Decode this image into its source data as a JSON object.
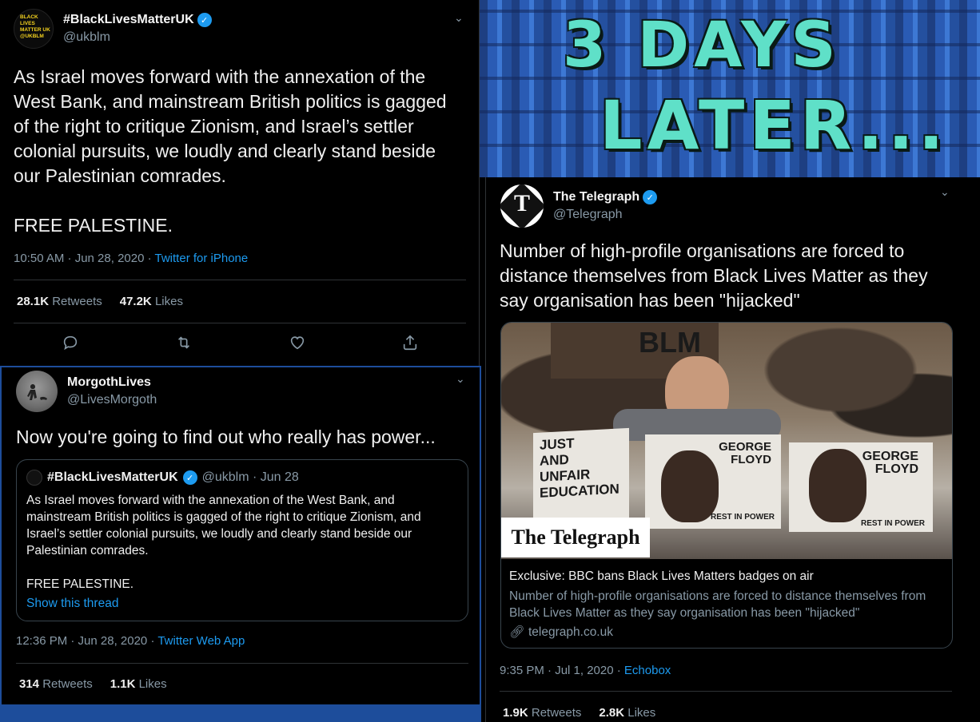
{
  "tweet1": {
    "display_name": "#BlackLivesMatterUK",
    "handle": "@ukblm",
    "avatar_text": "BLACK LIVES MATTER UK @UKBLM",
    "text": "As Israel moves forward with the annexation of the\nWest Bank, and mainstream British politics is gagged\nof the right to critique Zionism, and Israel’s settler\ncolonial pursuits, we loudly and clearly stand beside\nour Palestinian comrades.\n\nFREE PALESTINE.",
    "timestamp": "10:50 AM · Jun 28, 2020 · ",
    "app": "Twitter for iPhone",
    "retweets": "28.1K",
    "retweets_label": "Retweets",
    "likes": "47.2K",
    "likes_label": "Likes",
    "actions": [
      "reply-icon",
      "retweet-icon",
      "like-icon",
      "share-icon"
    ]
  },
  "tweet2": {
    "display_name": "MorgothLives",
    "handle": "@LivesMorgoth",
    "text": "Now you're going to find out who really has power...",
    "quote": {
      "display_name": "#BlackLivesMatterUK",
      "meta": "@ukblm · Jun 28",
      "text": "As Israel moves forward with the annexation of the West Bank, and\nmainstream British politics is gagged of the right to critique Zionism, and\nIsrael’s settler colonial pursuits, we loudly and clearly stand beside our\nPalestinian comrades.\n\nFREE PALESTINE.",
      "link": "Show this thread"
    },
    "timestamp": "12:36 PM · Jun 28, 2020 · ",
    "app": "Twitter Web App",
    "retweets": "314",
    "retweets_label": "Retweets",
    "likes": "1.1K",
    "likes_label": "Likes"
  },
  "banner": {
    "line1": "3 DAYS",
    "line2": "LATER...",
    "text_color": "#5fe0c8"
  },
  "tweet3": {
    "display_name": "The Telegraph",
    "handle": "@Telegraph",
    "avatar_letter": "T",
    "text": "Number of high-profile organisations are forced to\ndistance themselves from Black Lives Matter as they\nsay organisation has been \"hijacked\"",
    "card": {
      "image_texts": {
        "sign_top": "BLM",
        "poster_left": "JUST\nAND\nUNFAIR\nEDUCATION",
        "poster_mid_name": "GEORGE\nFLOYD",
        "poster_mid_footer": "REST IN POWER",
        "poster_right_name": "GEORGE\nFLOYD",
        "poster_right_footer": "REST IN POWER",
        "logo": "The Telegraph"
      },
      "title": "Exclusive: BBC bans Black Lives Matters badges on air",
      "description": "Number of high-profile organisations are forced to distance themselves from Black Lives Matter as they say organisation has been \"hijacked\"",
      "domain": "telegraph.co.uk"
    },
    "timestamp": "9:35 PM · Jul 1, 2020 · ",
    "app": "Echobox",
    "retweets": "1.9K",
    "retweets_label": "Retweets",
    "likes": "2.8K",
    "likes_label": "Likes"
  },
  "colors": {
    "link": "#1d9bf0",
    "muted": "#8899a6",
    "border": "#2f3336",
    "frame": "#1d4d9b"
  }
}
